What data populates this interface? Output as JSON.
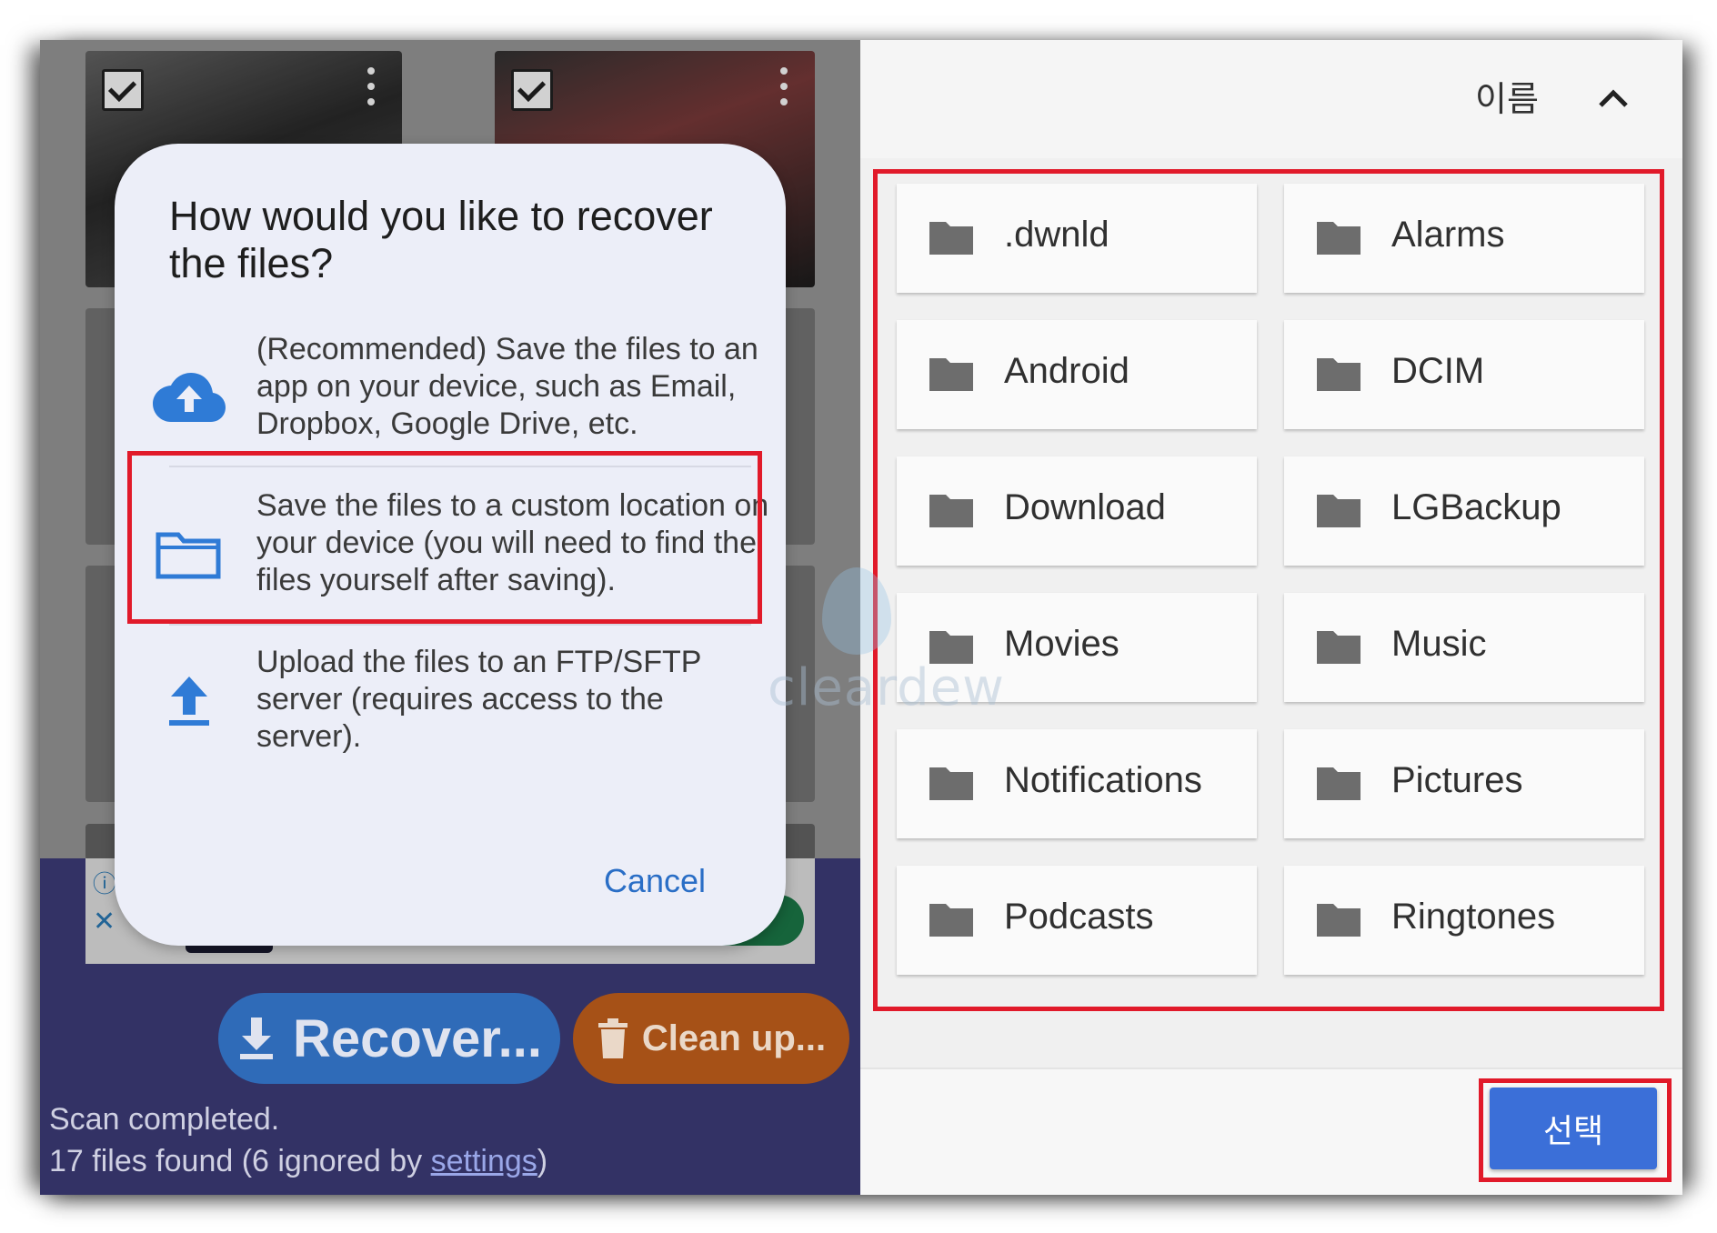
{
  "dialog": {
    "title": "How would you like to recover the files?",
    "options": [
      {
        "icon": "cloud-upload-icon",
        "text": "(Recommended) Save the files to an app on your device, such as Email, Dropbox, Google Drive, etc."
      },
      {
        "icon": "folder-icon",
        "text": "Save the files to a custom location on your device (you will need to find the files yourself after saving)."
      },
      {
        "icon": "upload-icon",
        "text": "Upload the files to an FTP/SFTP server (requires access to the server)."
      }
    ],
    "cancel_label": "Cancel"
  },
  "actions": {
    "recover_label": "Recover...",
    "cleanup_label": "Clean up..."
  },
  "status": {
    "line1": "Scan completed.",
    "line2_prefix": "17 files found (6 ignored by ",
    "line2_link": "settings",
    "line2_suffix": ")"
  },
  "watermark": "cleardew",
  "picker": {
    "sort_label": "이름",
    "folders": [
      ".dwnld",
      "Alarms",
      "Android",
      "DCIM",
      "Download",
      "LGBackup",
      "Movies",
      "Music",
      "Notifications",
      "Pictures",
      "Podcasts",
      "Ringtones"
    ],
    "select_label": "선택"
  },
  "colors": {
    "highlight": "#e11a2a",
    "accent_blue": "#2a6ec6",
    "select_button": "#3b6fd8",
    "recover_button": "#2f6bb8",
    "cleanup_button": "#a65117",
    "bottom_panel": "#3f3d7c"
  }
}
